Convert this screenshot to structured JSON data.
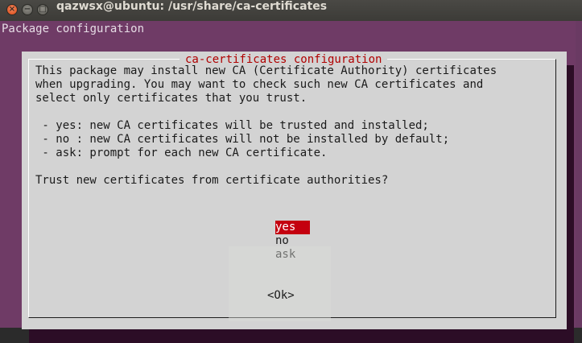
{
  "window": {
    "title": "qazwsx@ubuntu: /usr/share/ca-certificates",
    "close_glyph": "×",
    "minimize_glyph": "−",
    "maximize_glyph": "□"
  },
  "terminal": {
    "backtitle": "Package configuration"
  },
  "dialog": {
    "title": "ca-certificates configuration",
    "body": "This package may install new CA (Certificate Authority) certificates\nwhen upgrading. You may want to check such new CA certificates and\nselect only certificates that you trust.\n\n - yes: new CA certificates will be trusted and installed;\n - no : new CA certificates will not be installed by default;\n - ask: prompt for each new CA certificate.\n\nTrust new certificates from certificate authorities?",
    "options": [
      "yes",
      "no",
      "ask"
    ],
    "selected": "yes",
    "ok_label": "<Ok>"
  },
  "colors": {
    "terminal_bg": "#6f3b66",
    "dialog_bg": "#d3d3d3",
    "title_text": "#b00000",
    "selection_bg": "#c4000f"
  }
}
